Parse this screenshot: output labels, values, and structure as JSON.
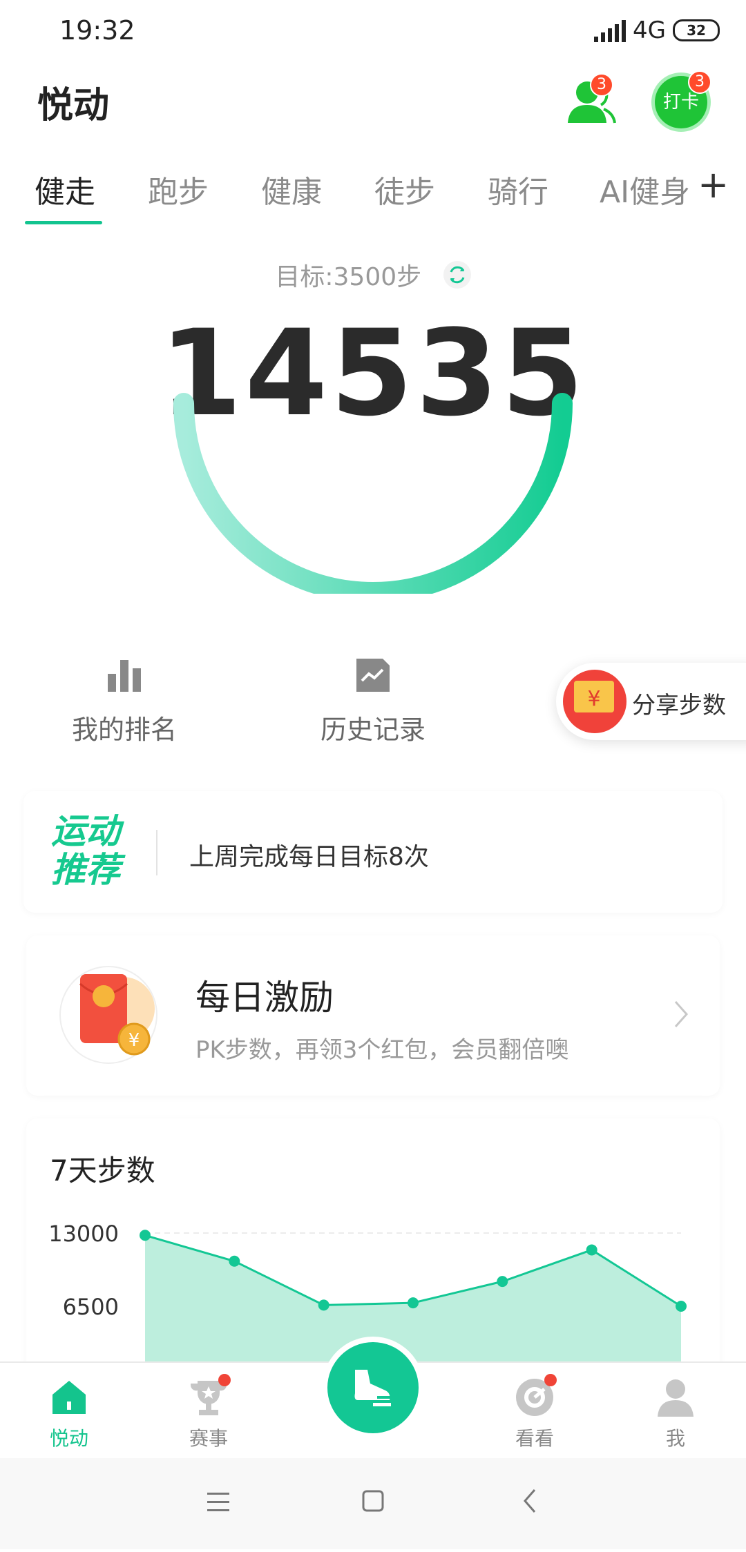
{
  "status": {
    "time": "19:32",
    "network": "4G",
    "battery": "32"
  },
  "header": {
    "title": "悦动",
    "friends_badge": "3",
    "checkin_label": "打卡",
    "checkin_badge": "3"
  },
  "tabs": [
    {
      "label": "健走",
      "active": true
    },
    {
      "label": "跑步"
    },
    {
      "label": "健康"
    },
    {
      "label": "徒步"
    },
    {
      "label": "骑行"
    },
    {
      "label": "AI健身"
    }
  ],
  "add_tab_label": "+",
  "goal": {
    "text": "目标:3500步"
  },
  "steps": {
    "value": "14535"
  },
  "shortcuts": {
    "ranking": "我的排名",
    "history": "历史记录",
    "share": "分享步数"
  },
  "recommend": {
    "badge_line1": "运动",
    "badge_line2": "推荐",
    "text": "上周完成每日目标8次"
  },
  "reward": {
    "title": "每日激励",
    "subtitle": "PK步数，再领3个红包，会员翻倍噢"
  },
  "chart_data": {
    "type": "area",
    "title": "7天步数",
    "y_ticks": [
      "13000",
      "6500"
    ],
    "values": [
      12800,
      10500,
      6600,
      6800,
      8700,
      11500,
      6500
    ],
    "ylim": [
      0,
      13000
    ],
    "accent": "#13c794"
  },
  "bottom_nav": [
    {
      "label": "悦动",
      "icon": "home-icon",
      "active": true
    },
    {
      "label": "赛事",
      "icon": "trophy-icon",
      "dot": true
    },
    {
      "label": "",
      "icon": "sneaker-icon"
    },
    {
      "label": "看看",
      "icon": "watch-icon",
      "dot": true
    },
    {
      "label": "我",
      "icon": "profile-icon"
    }
  ],
  "colors": {
    "accent": "#13c794",
    "badge": "#ff4a2b",
    "checkin": "#1fc437"
  }
}
